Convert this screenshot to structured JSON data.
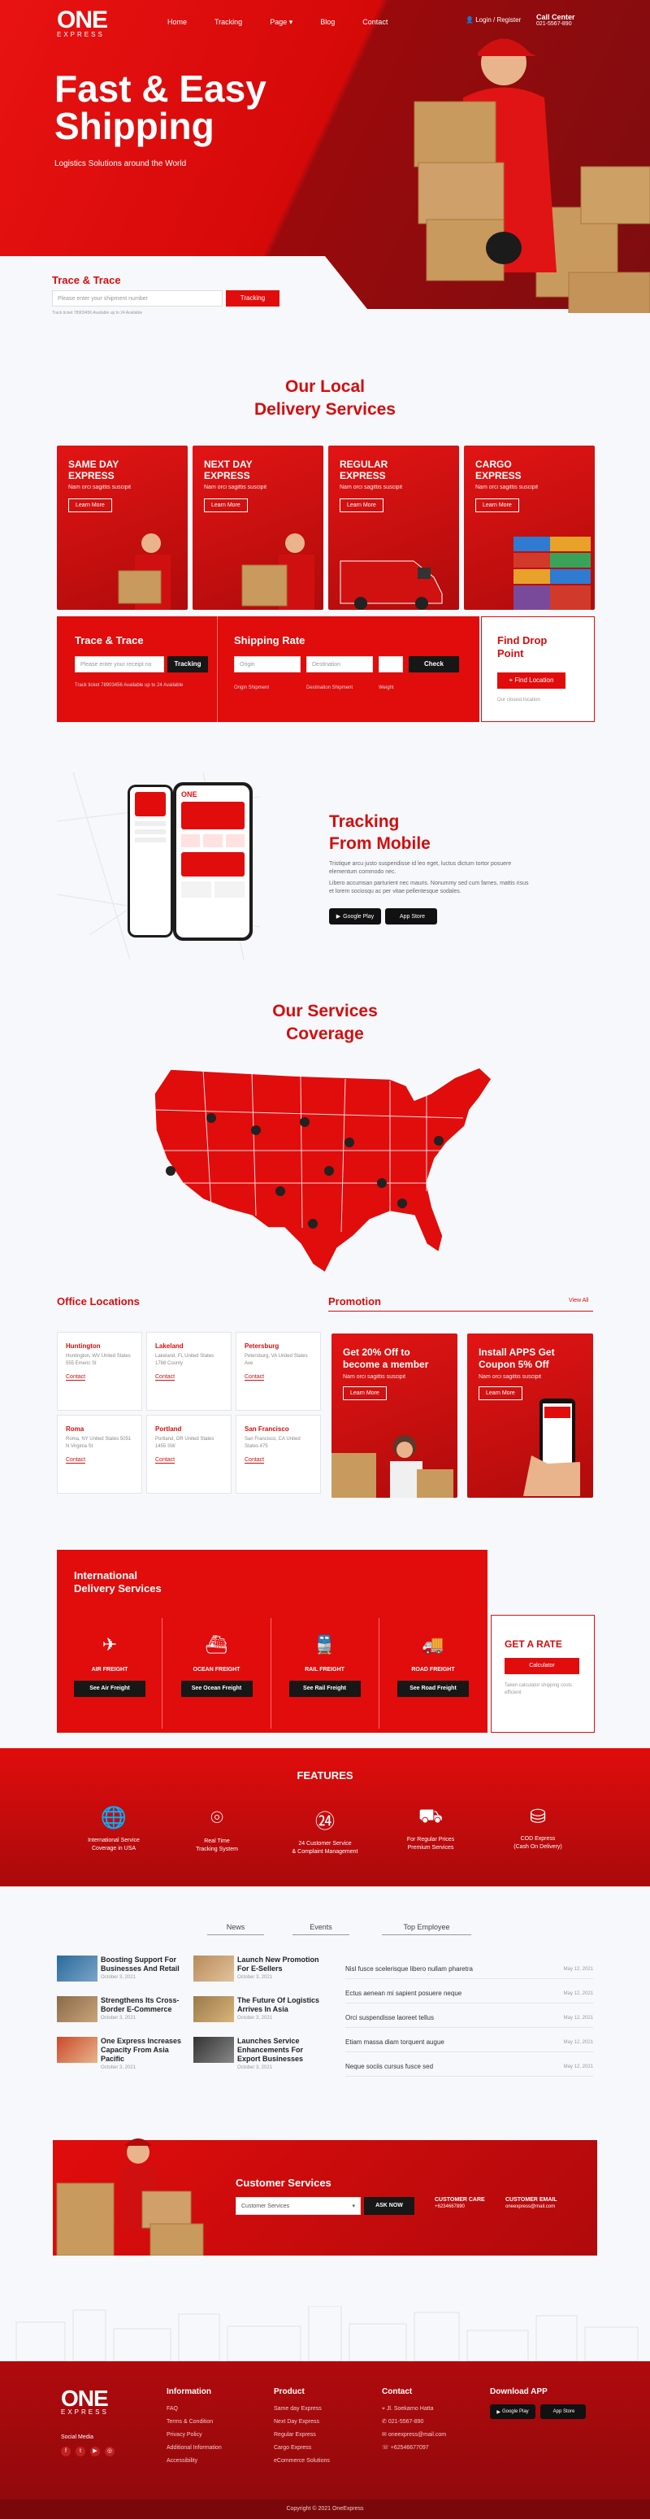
{
  "header": {
    "logo": "ONE",
    "logo_sub": "EXPRESS",
    "nav": [
      "Home",
      "Tracking",
      "Page",
      "Blog",
      "Contact"
    ],
    "login": "Login / Register",
    "call_title": "Call Center",
    "call_number": "021-5567-890"
  },
  "hero": {
    "title": "Fast & Easy Shipping",
    "subtitle": "Logistics Solutions around the World"
  },
  "trace": {
    "title": "Trace & Trace",
    "placeholder": "Please enter your shipment number",
    "button": "Tracking",
    "hint": "Track ticket 78903456 Available up to 24 Available"
  },
  "delivery": {
    "title_1": "Our Local",
    "title_2": "Delivery Services",
    "cards": [
      {
        "line1": "SAME DAY",
        "line2": "EXPRESS",
        "desc": "Nam orci sagittis suscipit",
        "btn": "Learn More"
      },
      {
        "line1": "NEXT DAY",
        "line2": "EXPRESS",
        "desc": "Nam orci sagittis suscipit",
        "btn": "Learn More"
      },
      {
        "line1": "REGULAR",
        "line2": "EXPRESS",
        "desc": "Nam orci sagittis suscipit",
        "btn": "Learn More"
      },
      {
        "line1": "CARGO",
        "line2": "EXPRESS",
        "desc": "Nam orci sagittis suscipit",
        "btn": "Learn More"
      }
    ]
  },
  "tools": {
    "trace_title": "Trace & Trace",
    "trace_placeholder": "Please enter your receipt no",
    "trace_btn": "Tracking",
    "trace_hint": "Track ticket 78903456 Available up to 24 Available",
    "rate_title": "Shipping Rate",
    "rate_origin": "Origin",
    "rate_dest": "Destination",
    "rate_btn": "Check",
    "rate_l1": "Origin Shipment",
    "rate_l2": "Destination Shipment",
    "rate_l3": "Weight",
    "drop_title_1": "Find Drop",
    "drop_title_2": "Point",
    "drop_btn": "Find Location",
    "drop_hint": "Our closest location"
  },
  "mobile": {
    "title_1": "Tracking",
    "title_2": "From Mobile",
    "p1": "Tristique arcu justo suspendisse id leo eget, luctus dictum tortor posuere elementum commodo nec.",
    "p2": "Libero accumsan parturient nec mauris. Nonummy sed cum fames, mattis risus et lorem sociosqu ac per vitae pellentesque sodales.",
    "gp": "Google Play",
    "as": "App Store",
    "phone_logo": "ONE"
  },
  "coverage": {
    "title_1": "Our Services",
    "title_2": "Coverage"
  },
  "offices": {
    "title": "Office Locations",
    "list": [
      {
        "city": "Huntington",
        "addr": "Huntington, WV United States 555 Emeric St",
        "contact": "Contact"
      },
      {
        "city": "Lakeland",
        "addr": "Lakeland, FL United States 1788 County",
        "contact": "Contact"
      },
      {
        "city": "Petersburg",
        "addr": "Petersburg, VA United States Ave",
        "contact": "Contact"
      },
      {
        "city": "Roma",
        "addr": "Roma, NY United States 5051 N Virginia St",
        "contact": "Contact"
      },
      {
        "city": "Portland",
        "addr": "Portland, OR United States 1455 SW",
        "contact": "Contact"
      },
      {
        "city": "San Francisco",
        "addr": "San Francisco, CA United States 475",
        "contact": "Contact"
      }
    ]
  },
  "promotion": {
    "title": "Promotion",
    "view_all": "View All",
    "p1_title": "Get 20% Off to become a member",
    "p1_desc": "Nam orci sagittis suscipit",
    "p1_btn": "Learn More",
    "p2_title": "Install APPS Get Coupon 5% Off",
    "p2_desc": "Nam orci sagittis suscipit",
    "p2_btn": "Learn More"
  },
  "intl": {
    "title_1": "International",
    "title_2": "Delivery Services",
    "items": [
      {
        "name": "AIR FREIGHT",
        "btn": "See Air Freight"
      },
      {
        "name": "OCEAN FREIGHT",
        "btn": "See Ocean Freight"
      },
      {
        "name": "RAIL FREIGHT",
        "btn": "See Rail Freight"
      },
      {
        "name": "ROAD FREIGHT",
        "btn": "See Road Freight"
      }
    ],
    "rate_title": "GET A RATE",
    "rate_btn": "Calculator",
    "rate_hint": "Taken calculator shipping costs efficient"
  },
  "features": {
    "title": "FEATURES",
    "items": [
      {
        "l1": "International Service",
        "l2": "Coverage in USA"
      },
      {
        "l1": "Real Time",
        "l2": "Tracking System"
      },
      {
        "l1": "24 Customer Service",
        "l2": "& Complaint Management"
      },
      {
        "l1": "For Regular Prices",
        "l2": "Premium Services"
      },
      {
        "l1": "COD Express",
        "l2": "(Cash On Delivery)"
      }
    ]
  },
  "blog": {
    "tabs": [
      "News",
      "Events",
      "Top Employee"
    ],
    "news": [
      {
        "title": "Boosting Support For Businesses And Retail",
        "date": "October 3, 2021"
      },
      {
        "title": "Launch New Promotion For E-Sellers",
        "date": "October 3, 2021"
      },
      {
        "title": "Strengthens Its Cross-Border E-Commerce",
        "date": "October 3, 2021"
      },
      {
        "title": "The Future Of Logistics Arrives In Asia",
        "date": "October 3, 2021"
      },
      {
        "title": "One Express Increases Capacity From Asia Pacific",
        "date": "October 3, 2021"
      },
      {
        "title": "Launches Service Enhancements For Export Businesses",
        "date": "October 3, 2021"
      }
    ],
    "list": [
      {
        "t": "Nisl fusce scelerisque libero nullam pharetra",
        "d": "May 12, 2021"
      },
      {
        "t": "Ectus aenean mi sapient posuere neque",
        "d": "May 12, 2021"
      },
      {
        "t": "Orci suspendisse laoreet tellus",
        "d": "May 12, 2021"
      },
      {
        "t": "Etiam massa diam torquent augue",
        "d": "May 12, 2021"
      },
      {
        "t": "Neque sociis cursus fusce sed",
        "d": "May 12, 2021"
      }
    ]
  },
  "cs": {
    "title": "Customer Services",
    "select": "Customer Services",
    "btn": "ASK NOW",
    "care_label": "CUSTOMER CARE",
    "care_value": "+6234667890",
    "email_label": "CUSTOMER EMAIL",
    "email_value": "oneexpress@mail.com"
  },
  "footer": {
    "logo": "ONE",
    "logo_sub": "EXPRESS",
    "social": "Social Media",
    "info_title": "Information",
    "info": [
      "FAQ",
      "Terms & Condition",
      "Privacy Policy",
      "Additional Information",
      "Accessibility"
    ],
    "prod_title": "Product",
    "prod": [
      "Same day Express",
      "Next Day Express",
      "Regular Express",
      "Cargo Express",
      "eCommerce Solutions"
    ],
    "contact_title": "Contact",
    "contact": [
      "Jl. Soekarno Hatta",
      "021-5567-890",
      "oneexpress@mail.com",
      "+62546677097"
    ],
    "app_title": "Download APP",
    "gp": "Google Play",
    "as": "App Store",
    "copyright": "Copyright © 2021 OneExpress"
  },
  "colors": {
    "brand": "#e10c0c",
    "dark": "#171717"
  }
}
